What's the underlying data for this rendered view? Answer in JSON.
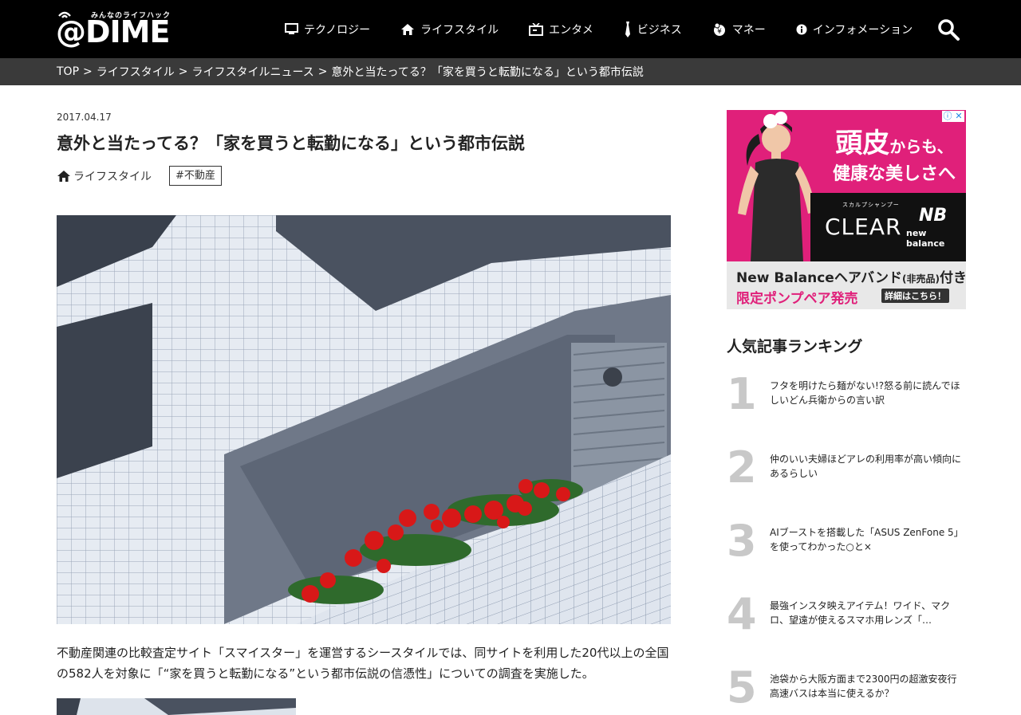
{
  "header": {
    "logo_text": "@DIME",
    "logo_tagline": "みんなのライフハック",
    "nav": [
      {
        "label": "テクノロジー",
        "icon": "monitor-icon"
      },
      {
        "label": "ライフスタイル",
        "icon": "home-icon"
      },
      {
        "label": "エンタメ",
        "icon": "tv-icon"
      },
      {
        "label": "ビジネス",
        "icon": "tie-icon"
      },
      {
        "label": "マネー",
        "icon": "money-icon"
      },
      {
        "label": "インフォメーション",
        "icon": "info-icon"
      }
    ],
    "search_icon": "search-icon"
  },
  "breadcrumb": {
    "items": [
      "TOP",
      "ライフスタイル",
      "ライフスタイルニュース",
      "意外と当たってる？「家を買うと転勤になる」という都市伝説"
    ],
    "separator": ">"
  },
  "article": {
    "date": "2017.04.17",
    "title": "意外と当たってる？「家を買うと転勤になる」という都市伝説",
    "category": "ライフスタイル",
    "tag": "#不動産",
    "body": "不動産関連の比較査定サイト「スマイスター」を運営するシースタイルでは、同サイトを利用した20代以上の全国の582人を対象に「“家を買うと転勤になる”という都市伝説の信憑性」についての調査を実施した。"
  },
  "ad": {
    "headline1_big": "頭皮",
    "headline1_small": "からも、",
    "headline2": "健康な美しさへ",
    "brand_kana": "スカルプシャンプー",
    "brand": "CLEAR",
    "partner": "new balance",
    "line1_main": "New Balanceヘアバンド",
    "line1_small": "(非売品)",
    "line1_end": "付き",
    "line2": "限定ポンプペア発売",
    "button": "詳細はこちら！"
  },
  "ranking": {
    "title": "人気記事ランキング",
    "items": [
      {
        "rank": "1",
        "text": "フタを明けたら麺がない!?怒る前に読んでほしいどん兵衛からの言い訳"
      },
      {
        "rank": "2",
        "text": "仲のいい夫婦ほどアレの利用率が高い傾向にあるらしい"
      },
      {
        "rank": "3",
        "text": "AIブーストを搭載した「ASUS ZenFone 5」を使ってわかった○と×"
      },
      {
        "rank": "4",
        "text": "最強インスタ映えアイテム！ワイド、マクロ、望遠が使えるスマホ用レンズ「…"
      },
      {
        "rank": "5",
        "text": "池袋から大阪方面まで2300円の超激安夜行高速バスは本当に使えるか？"
      }
    ]
  }
}
